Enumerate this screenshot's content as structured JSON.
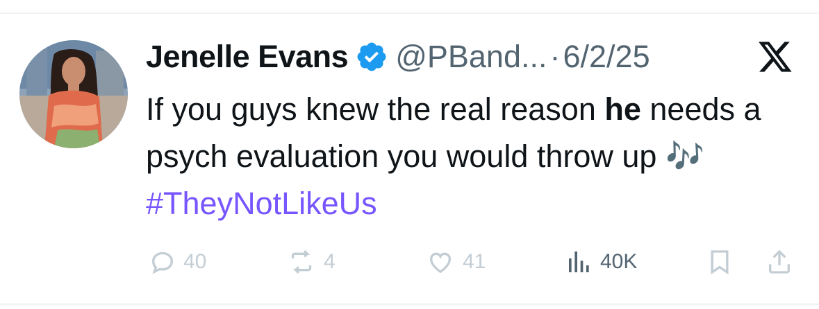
{
  "tweet": {
    "author_name": "Jenelle Evans",
    "author_handle": "@PBand...",
    "separator": "·",
    "date": "6/2/25",
    "text": {
      "part1": "If you guys knew the real reason ",
      "bold": "he",
      "part2": " needs a psych evaluation you would throw up ",
      "emoji": "🎶",
      "hashtag": "#TheyNotLikeUs"
    }
  },
  "actions": {
    "replies": "40",
    "reposts": "4",
    "likes": "41",
    "views": "40K"
  },
  "colors": {
    "text": "#0f1419",
    "secondary": "#536471",
    "verified": "#1d9bf0",
    "hashtag": "#7856ff",
    "faded_action": "#c3cdd4"
  },
  "icons": [
    "verified-badge-icon",
    "x-logo-icon",
    "reply-icon",
    "repost-icon",
    "like-icon",
    "views-icon",
    "bookmark-icon",
    "share-icon"
  ]
}
